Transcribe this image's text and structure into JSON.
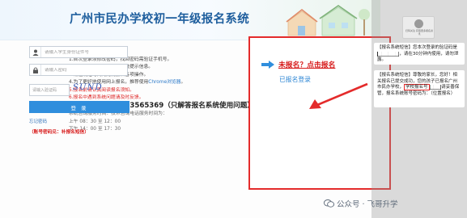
{
  "header": {
    "title": "广州市民办学校初一年级报名系统"
  },
  "notes": {
    "line1": "1.首次登录须修改密码，找回密码需验证手机号。",
    "line2": "2.网上报名期间注意查看系统提示信息。",
    "line3": "3.请在规定时间内完成报名各项操作。",
    "line4_prefix": "4.为了更好地使用网上报名，推荐使用",
    "line4_link": "Chrome浏览器",
    "line4_suffix": "。",
    "line5": "5.报名前请认真阅读报名须知。",
    "line6": "6.报名中遇到系统问题请及时反馈。",
    "line7": "7.技术咨询热线：83565369（只解答报名系统使用问题）",
    "service_title": "系统咨询服务时间：技术咨询电话服务时间为：",
    "service_am": "上午 08：30 至 12：00",
    "service_pm": "下午 14：00 至 17：30"
  },
  "login": {
    "register_link": "未报名？点击报名",
    "section_title": "已报名登录",
    "account_placeholder": "请输入学生身份证件号",
    "password_placeholder": "请输入密码",
    "captcha_placeholder": "请输入验证码",
    "captcha_text": "SUND",
    "login_button": "登 录",
    "forgot_password": "忘记密码",
    "hint": "（账号密码见：补报名短信）"
  },
  "sidebar": {
    "qr_caption": "扫码关注 获取更多报名资讯",
    "tip1_tag": "【报名系统短信】",
    "tip1_body": "您本次登录的验证码是",
    "tip1_suffix": "，请在30分钟内使用，请勿泄露。",
    "tip2_tag": "【报名系统短信】",
    "tip2_body": "尊敬的家长，您好！相关报名已提交成功，您的孩子已报名广州市民办学校，",
    "tip2_code": "学校报名号",
    "tip2_suffix": "请妥善保管，报名系统账号密码为：（位置报名）"
  },
  "watermark": {
    "text": "公众号 · 飞哥升学"
  },
  "colors": {
    "accent_blue": "#2f8edd",
    "title_blue": "#1f5f9e",
    "alert_red": "#e42b2b"
  }
}
